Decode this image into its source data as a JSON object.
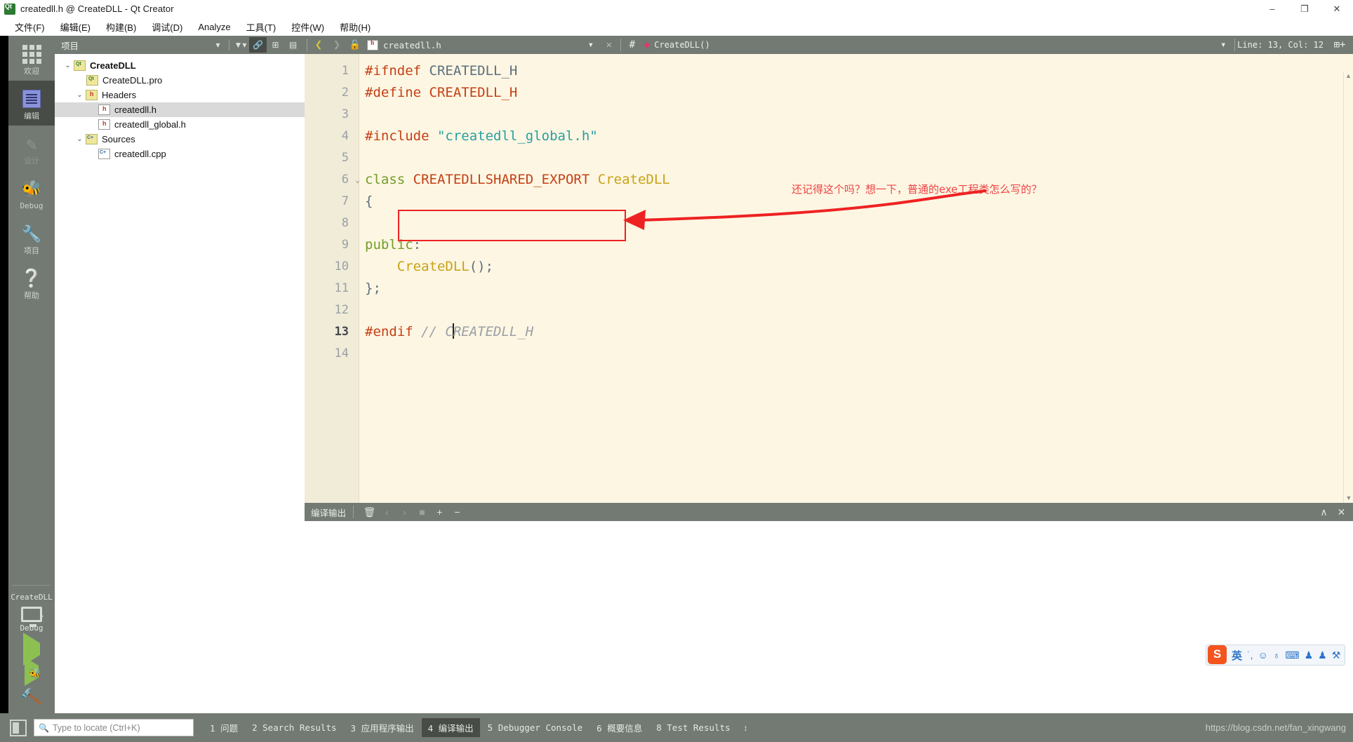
{
  "window": {
    "title": "createdll.h @ CreateDLL - Qt Creator",
    "app_icon": "qt-logo-icon",
    "minimize": "–",
    "maximize": "❐",
    "close": "✕"
  },
  "menubar": {
    "items": [
      {
        "label": "文件(F)",
        "name": "menu-file"
      },
      {
        "label": "编辑(E)",
        "name": "menu-edit"
      },
      {
        "label": "构建(B)",
        "name": "menu-build"
      },
      {
        "label": "调试(D)",
        "name": "menu-debug"
      },
      {
        "label": "Analyze",
        "name": "menu-analyze"
      },
      {
        "label": "工具(T)",
        "name": "menu-tools"
      },
      {
        "label": "控件(W)",
        "name": "menu-window"
      },
      {
        "label": "帮助(H)",
        "name": "menu-help"
      }
    ]
  },
  "modebar": {
    "items": [
      {
        "label": "欢迎",
        "icon": "grid-icon",
        "state": "normal"
      },
      {
        "label": "编辑",
        "icon": "document-lines-icon",
        "state": "active"
      },
      {
        "label": "设计",
        "icon": "pencil-icon",
        "state": "disabled"
      },
      {
        "label": "Debug",
        "icon": "bug-icon",
        "state": "normal"
      },
      {
        "label": "项目",
        "icon": "wrench-icon",
        "state": "normal"
      },
      {
        "label": "帮助",
        "icon": "question-circle-icon",
        "state": "normal"
      }
    ],
    "kit": {
      "project": "CreateDLL",
      "config": "Debug",
      "monitor_icon": "monitor-icon",
      "run_icon": "run-triangle-icon",
      "debug_icon": "run-debug-icon",
      "build_icon": "hammer-icon"
    }
  },
  "project_panel": {
    "header": {
      "title": "项目",
      "combo_caret": "▾",
      "filter_icon": "filter-icon",
      "link_icon": "link-sync-icon",
      "split_icon": "add-split-icon",
      "close_icon": "close-panel-icon"
    },
    "tree": [
      {
        "label": "CreateDLL",
        "indent": 0,
        "chevron": "⌄",
        "icon": "qt-project-icon",
        "bold": true,
        "selected": false
      },
      {
        "label": "CreateDLL.pro",
        "indent": 1,
        "chevron": "",
        "icon": "qt-pro-file-icon",
        "bold": false,
        "selected": false
      },
      {
        "label": "Headers",
        "indent": 1,
        "chevron": "⌄",
        "icon": "headers-folder-icon",
        "bold": false,
        "selected": false
      },
      {
        "label": "createdll.h",
        "indent": 2,
        "chevron": "",
        "icon": "header-file-icon",
        "bold": false,
        "selected": true
      },
      {
        "label": "createdll_global.h",
        "indent": 2,
        "chevron": "",
        "icon": "header-file-icon",
        "bold": false,
        "selected": false
      },
      {
        "label": "Sources",
        "indent": 1,
        "chevron": "⌄",
        "icon": "sources-folder-icon",
        "bold": false,
        "selected": false
      },
      {
        "label": "createdll.cpp",
        "indent": 2,
        "chevron": "",
        "icon": "cpp-file-icon",
        "bold": false,
        "selected": false
      }
    ]
  },
  "editor": {
    "toolbar": {
      "back_icon": "back-arrow-icon",
      "forward_icon": "forward-arrow-icon",
      "lock_icon": "unlocked-padlock-icon",
      "file_icon": "header-file-icon",
      "filename": "createdll.h",
      "dropdown_caret": "▾",
      "close_icon": "✕",
      "hash_icon": "#",
      "symbol_dot": "◆",
      "symbol": "CreateDLL()",
      "symbol_caret": "▾",
      "cursor_position": "Line: 13, Col: 12",
      "split_icon": "split-editor-icon"
    },
    "lines": [
      {
        "n": "1",
        "fold": "",
        "current": false,
        "tokens": [
          {
            "t": "#ifndef ",
            "c": "pre"
          },
          {
            "t": "CREATEDLL_H",
            "c": "id"
          }
        ]
      },
      {
        "n": "2",
        "fold": "",
        "current": false,
        "tokens": [
          {
            "t": "#define ",
            "c": "pre"
          },
          {
            "t": "CREATEDLL_H",
            "c": "pre"
          }
        ]
      },
      {
        "n": "3",
        "fold": "",
        "current": false,
        "tokens": []
      },
      {
        "n": "4",
        "fold": "",
        "current": false,
        "tokens": [
          {
            "t": "#include ",
            "c": "pre"
          },
          {
            "t": "\"createdll_global.h\"",
            "c": "str"
          }
        ]
      },
      {
        "n": "5",
        "fold": "",
        "current": false,
        "tokens": []
      },
      {
        "n": "6",
        "fold": "⌄",
        "current": false,
        "tokens": [
          {
            "t": "class ",
            "c": "kw"
          },
          {
            "t": "CREATEDLLSHARED_EXPORT",
            "c": "pre"
          },
          {
            "t": " ",
            "c": "pun"
          },
          {
            "t": "CreateDLL",
            "c": "type"
          }
        ]
      },
      {
        "n": "7",
        "fold": "",
        "current": false,
        "tokens": [
          {
            "t": "{",
            "c": "pun"
          }
        ]
      },
      {
        "n": "8",
        "fold": "",
        "current": false,
        "tokens": []
      },
      {
        "n": "9",
        "fold": "",
        "current": false,
        "tokens": [
          {
            "t": "public",
            "c": "kw"
          },
          {
            "t": ":",
            "c": "pun"
          }
        ]
      },
      {
        "n": "10",
        "fold": "",
        "current": false,
        "tokens": [
          {
            "t": "    ",
            "c": "pun"
          },
          {
            "t": "CreateDLL",
            "c": "type"
          },
          {
            "t": "();",
            "c": "pun"
          }
        ]
      },
      {
        "n": "11",
        "fold": "",
        "current": false,
        "tokens": [
          {
            "t": "};",
            "c": "pun"
          }
        ]
      },
      {
        "n": "12",
        "fold": "",
        "current": false,
        "tokens": []
      },
      {
        "n": "13",
        "fold": "",
        "current": true,
        "tokens": [
          {
            "t": "#endif ",
            "c": "pre"
          },
          {
            "t": "// C",
            "c": "com"
          },
          {
            "t": "|CARET|",
            "c": "caret"
          },
          {
            "t": "REATEDLL_H",
            "c": "com"
          }
        ]
      },
      {
        "n": "14",
        "fold": "",
        "current": false,
        "tokens": []
      }
    ],
    "annotation": {
      "text": "还记得这个吗？想一下，普通的exe工程类怎么写的？",
      "color": "#ef4444",
      "highlight_box_target": "CREATEDLLSHARED_EXPORT"
    }
  },
  "output_pane": {
    "title": "编译输出",
    "buttons": [
      {
        "icon": "clear-output-icon",
        "name": "clear-output-button"
      },
      {
        "icon": "‹",
        "name": "prev-item-button"
      },
      {
        "icon": "›",
        "name": "next-item-button"
      },
      {
        "icon": "■",
        "name": "stop-button"
      },
      {
        "icon": "+",
        "name": "increase-font-button"
      },
      {
        "icon": "−",
        "name": "decrease-font-button"
      }
    ],
    "right_buttons": [
      {
        "icon": "∧",
        "name": "maximize-pane-button"
      },
      {
        "icon": "✕",
        "name": "close-pane-button"
      }
    ],
    "content": ""
  },
  "statusbar": {
    "toggle_sidebar_icon": "toggle-sidebar-icon",
    "locator_placeholder": "Type to locate (Ctrl+K)",
    "locator_value": "",
    "search_icon": "search-icon",
    "tabs": [
      {
        "num": "1",
        "label": "问题",
        "active": false
      },
      {
        "num": "2",
        "label": "Search Results",
        "active": false
      },
      {
        "num": "3",
        "label": "应用程序输出",
        "active": false
      },
      {
        "num": "4",
        "label": "编译输出",
        "active": true
      },
      {
        "num": "5",
        "label": "Debugger Console",
        "active": false
      },
      {
        "num": "6",
        "label": "概要信息",
        "active": false
      },
      {
        "num": "8",
        "label": "Test Results",
        "active": false
      }
    ],
    "updown_icon": "↕",
    "watermark": "https://blog.csdn.net/fan_xingwang"
  },
  "ime": {
    "logo": "S",
    "items": [
      {
        "glyph": "英",
        "name": "ime-mode-english"
      },
      {
        "glyph": "˙,",
        "name": "ime-punctuation"
      },
      {
        "glyph": "☺",
        "name": "ime-emoji"
      },
      {
        "glyph": "♁",
        "name": "ime-voice-input"
      },
      {
        "glyph": "⌨",
        "name": "ime-soft-keyboard"
      },
      {
        "glyph": "♟",
        "name": "ime-toolbox"
      },
      {
        "glyph": "♟",
        "name": "ime-skin"
      },
      {
        "glyph": "⚒",
        "name": "ime-settings"
      }
    ]
  }
}
